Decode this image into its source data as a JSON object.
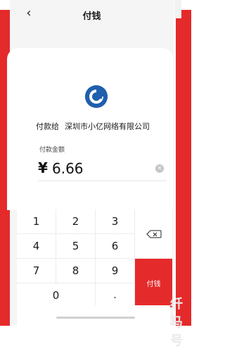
{
  "header": {
    "back_icon": "chevron-left-icon",
    "title": "付钱"
  },
  "payee": {
    "prefix": "付款给",
    "name": "深圳市小亿网络有限公司",
    "logo_icon": "bank-logo-icon",
    "logo_color": "#1f5fae"
  },
  "amount": {
    "label": "付款金额",
    "currency_symbol": "¥",
    "value": "6.66",
    "clear_icon": "clear-icon"
  },
  "keypad": {
    "keys": [
      "1",
      "2",
      "3",
      "4",
      "5",
      "6",
      "7",
      "8",
      "9",
      "0",
      "."
    ],
    "delete_icon": "backspace-icon",
    "pay_label": "付钱"
  },
  "watermark": "纤马号",
  "colors": {
    "accent_red": "#e52a2b",
    "sheet_bg": "#f5f5f5",
    "logo_blue": "#1f5fae"
  }
}
